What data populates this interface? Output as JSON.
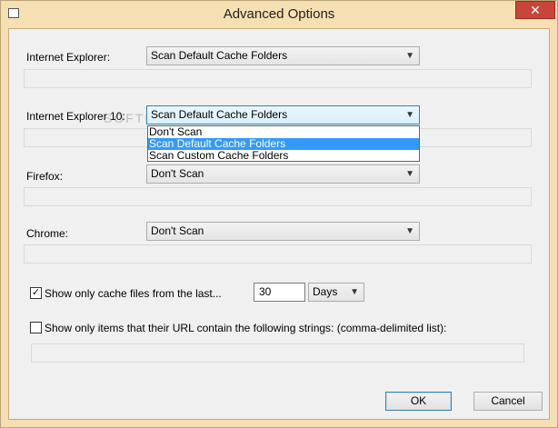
{
  "window": {
    "title": "Advanced Options",
    "close_glyph": "✕",
    "accent": "#f6dfb2"
  },
  "browsers": [
    {
      "label": "Internet Explorer:",
      "selected": "Scan Default Cache Folders"
    },
    {
      "label": "Internet Explorer 10:",
      "selected": "Scan Default Cache Folders"
    },
    {
      "label": "Firefox:",
      "selected": "Don't Scan"
    },
    {
      "label": "Chrome:",
      "selected": "Don't Scan"
    }
  ],
  "dropdown_options": [
    "Don't Scan",
    "Scan Default Cache Folders",
    "Scan Custom Cache Folders"
  ],
  "highlighted_option": "Scan Default Cache Folders",
  "cache_filter": {
    "checked": true,
    "label": "Show only cache files from the last...",
    "value": "30",
    "unit": "Days"
  },
  "url_filter": {
    "checked": false,
    "label": "Show only items that their URL contain the following strings: (comma-delimited list):",
    "value": ""
  },
  "buttons": {
    "ok": "OK",
    "cancel": "Cancel"
  },
  "watermark": "SOFTPEDIA",
  "colors": {
    "selection": "#3399ff",
    "close": "#c7463b"
  }
}
